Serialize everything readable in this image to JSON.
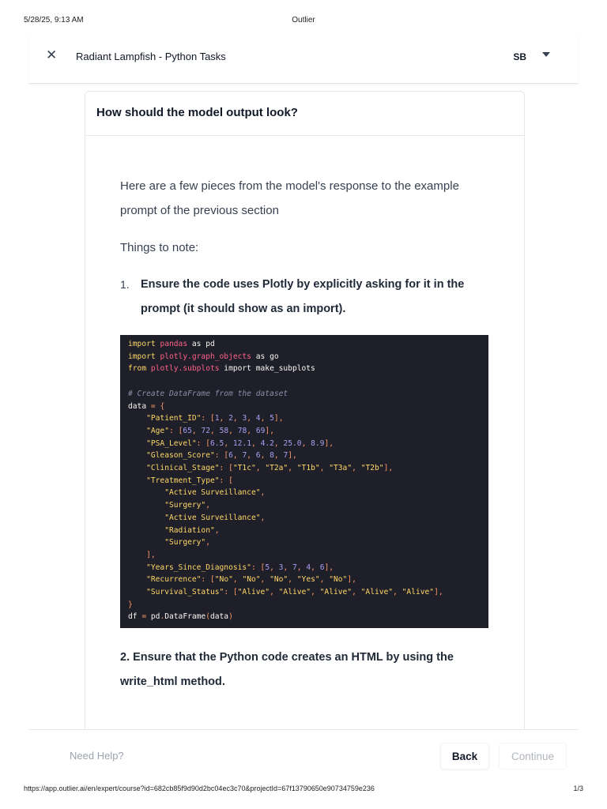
{
  "print": {
    "datetime": "5/28/25, 9:13 AM",
    "title": "Outlier",
    "url": "https://app.outlier.ai/en/expert/course?id=682cb85f9d90d2bc04ec3c70&projectId=67f13790650e90734759e236",
    "page": "1/3"
  },
  "topbar": {
    "close_icon": "close-icon",
    "course_title": "Radiant Lampfish - Python Tasks",
    "user_initials": "SB"
  },
  "card": {
    "title": "How should the model output look?",
    "intro": "Here are a few pieces from the model's response to the example prompt of the previous section",
    "note_label": "Things to note:",
    "step1_number": "1.",
    "step1_text": "Ensure the code uses Plotly by explicitly asking for it in the prompt (it should show as an import).",
    "step2_text": "2. Ensure that the Python code creates an HTML by using the write_html method."
  },
  "code": {
    "lines": [
      "import pandas as pd",
      "import plotly.graph_objects as go",
      "from plotly.subplots import make_subplots",
      "",
      "# Create DataFrame from the dataset",
      "data = {",
      "    \"Patient_ID\": [1, 2, 3, 4, 5],",
      "    \"Age\": [65, 72, 58, 78, 69],",
      "    \"PSA_Level\": [6.5, 12.1, 4.2, 25.0, 8.9],",
      "    \"Gleason_Score\": [6, 7, 6, 8, 7],",
      "    \"Clinical_Stage\": [\"T1c\", \"T2a\", \"T1b\", \"T3a\", \"T2b\"],",
      "    \"Treatment_Type\": [",
      "        \"Active Surveillance\",",
      "        \"Surgery\",",
      "        \"Active Surveillance\",",
      "        \"Radiation\",",
      "        \"Surgery\",",
      "    ],",
      "    \"Years_Since_Diagnosis\": [5, 3, 7, 4, 6],",
      "    \"Recurrence\": [\"No\", \"No\", \"No\", \"Yes\", \"No\"],",
      "    \"Survival_Status\": [\"Alive\", \"Alive\", \"Alive\", \"Alive\", \"Alive\"],",
      "}",
      "df = pd.DataFrame(data)"
    ]
  },
  "footer": {
    "help_label": "Need Help?",
    "back_label": "Back",
    "continue_label": "Continue"
  }
}
